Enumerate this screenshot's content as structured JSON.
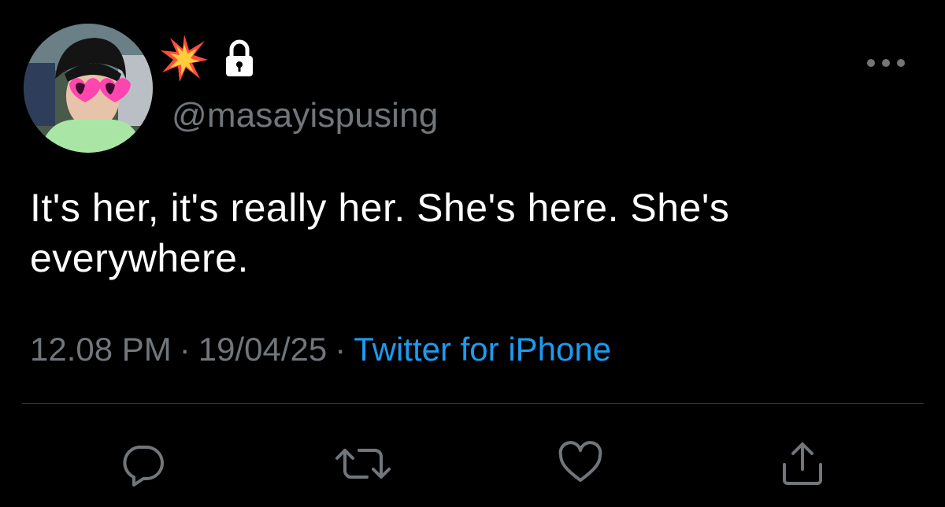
{
  "tweet": {
    "handle": "@masayispusing",
    "text": "It's her, it's really her. She's here. She's everywhere.",
    "time": "12.08 PM",
    "date": "19/04/25",
    "separator": "·",
    "source": "Twitter for iPhone"
  },
  "icons": {
    "name_emoji": "collision-icon",
    "protected": "lock-icon",
    "more": "more-icon",
    "reply": "reply-icon",
    "retweet": "retweet-icon",
    "like": "heart-icon",
    "share": "share-icon"
  },
  "colors": {
    "background": "#000000",
    "text": "#ffffff",
    "secondary": "#71767b",
    "link": "#1d9bf0",
    "divider": "#2f3336"
  }
}
